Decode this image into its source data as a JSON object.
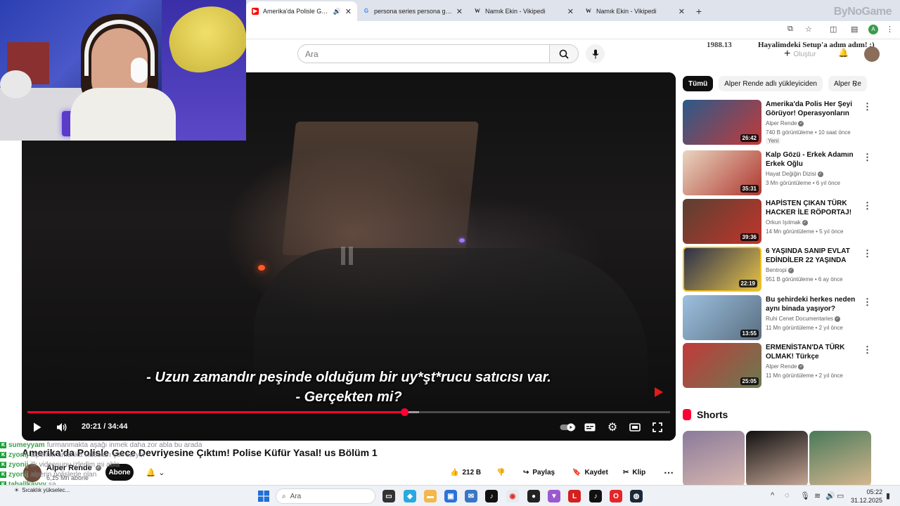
{
  "browser": {
    "tabs": [
      {
        "title": "Amerika'da Polisle Gece Devriyesine Çıktım!",
        "favicon": "youtube-icon",
        "active": true,
        "audio": true
      },
      {
        "title": "persona series persona game p",
        "favicon": "google-icon",
        "active": false
      },
      {
        "title": "Namık Ekin - Vikipedi",
        "favicon": "wikipedia-icon",
        "active": false
      },
      {
        "title": "Namık Ekin - Vikipedi",
        "favicon": "wikipedia-icon",
        "active": false
      }
    ],
    "new_tab": "+",
    "watermark": "ByNoGame",
    "profile_letter": "A"
  },
  "youtube": {
    "search_placeholder": "Ara",
    "create_label": "Oluştur",
    "overlay_year": "1988.13",
    "overlay_banner": "Hayalimdeki Setup'a adım adım! :)"
  },
  "player": {
    "subtitle_line1": "- Uzun zamandır peşinde olduğum bir uy*şt*rucu satıcısı var.",
    "subtitle_line2": "- Gerçekten mi?",
    "current_time": "20:21",
    "duration": "34:44",
    "time_display": "20:21 / 34:44",
    "progress_fraction": 0.586,
    "buffer_fraction": 0.609,
    "accent": "#ff0033"
  },
  "video": {
    "title": "Amerika'da Polisle Gece Devriyesine Çıktım! Polise Küfür Yasal! us Bölüm 1",
    "channel": "Alper Rende",
    "subscribers": "6,15 Mn abone",
    "subscribe_label": "Abone",
    "likes": "212 B",
    "share_label": "Paylaş",
    "save_label": "Kaydet",
    "clip_label": "Klip"
  },
  "chat": [
    {
      "user": "sumeyyam",
      "message": "furmanmakta aşağı inmek daha zor abla bu arada"
    },
    {
      "user": "zyonij",
      "message": "alpernin amerika videoları çok saryor"
    },
    {
      "user": "zyonij",
      "message": "ilk videosunu izledim mi abla"
    },
    {
      "user": "zyonij",
      "message": "alperin polislerle olan"
    },
    {
      "user": "tahallkayyy",
      "message": "sa"
    }
  ],
  "sidebar": {
    "chips": [
      "Tümü",
      "Alper Rende adlı yükleyiciden",
      "Alper Re"
    ],
    "recommendations": [
      {
        "title": "Amerika'da Polis Her Şeyi Görüyor! Operasyonların Perde...",
        "channel": "Alper Rende",
        "meta": "740 B görüntüleme • 10 saat önce",
        "badge": "Yeni",
        "duration": "26:42",
        "color": "#2b5a8a"
      },
      {
        "title": "Kalp Gözü - Erkek Adamın Erkek Oğlu",
        "channel": "Hayat Değiğin Dizisi",
        "meta": "3 Mn görüntüleme • 6 yıl önce",
        "badge": "",
        "duration": "35:31",
        "color": "#c9b59b"
      },
      {
        "title": "HAPİSTEN ÇIKAN TÜRK HACKER İLE RÖPORTAJ!",
        "channel": "Orkun Işıtmak",
        "meta": "14 Mn görüntüleme • 5 yıl önce",
        "badge": "",
        "duration": "39:36",
        "color": "#4a3a30"
      },
      {
        "title": "6 YAŞINDA SANIP EVLAT EDİNDİLER 22 YAŞINDA ÇIKTI",
        "channel": "Bentropi",
        "meta": "951 B görüntüleme • 6 ay önce",
        "badge": "",
        "duration": "22:19",
        "color": "#3a3f5a"
      },
      {
        "title": "Bu şehirdeki herkes neden aynı binada yaşıyor? Dünyanın En ...",
        "channel": "Ruhi Cenet Documentaries",
        "meta": "11 Mn görüntüleme • 2 yıl önce",
        "badge": "",
        "duration": "13:55",
        "color": "#6a8aa8"
      },
      {
        "title": "ERMENİSTAN'DA TÜRK OLMAK! Türkçe konuştuğumuzu duyan ...",
        "channel": "Alper Rende",
        "meta": "11 Mn görüntüleme • 2 yıl önce",
        "badge": "",
        "duration": "25:05",
        "color": "#5a6a4a"
      }
    ],
    "shorts_label": "Shorts",
    "shorts_colors": [
      "#8a7a9a",
      "#b8a898",
      "#a89070"
    ]
  },
  "taskbar": {
    "search_placeholder": "Ara",
    "time": "05:22",
    "date": "31.12.2025",
    "weather_text": "Sıcaklık yükselec..."
  }
}
